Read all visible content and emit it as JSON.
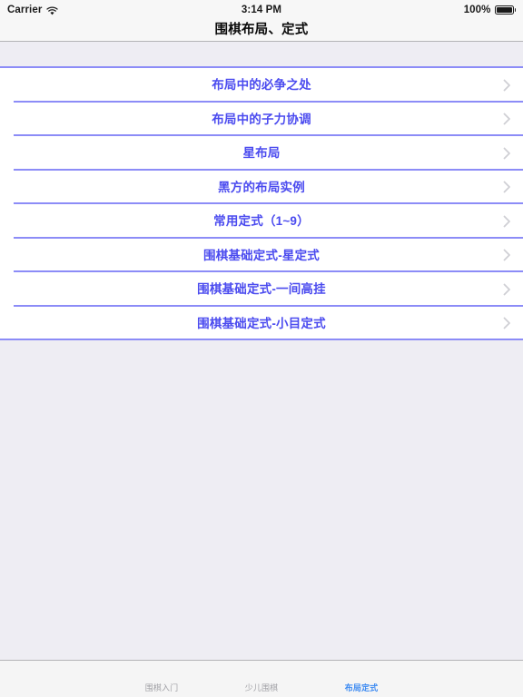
{
  "status_bar": {
    "carrier": "Carrier",
    "wifi_icon": "wifi-icon",
    "time": "3:14 PM",
    "battery_percent": "100%",
    "battery_icon": "battery-full-icon"
  },
  "nav_bar": {
    "title": "围棋布局、定式"
  },
  "list": {
    "chevron_icon": "chevron-right-icon",
    "rows": [
      {
        "label": "布局中的必争之处"
      },
      {
        "label": "布局中的子力协调"
      },
      {
        "label": "星布局"
      },
      {
        "label": "黑方的布局实例"
      },
      {
        "label": "常用定式（1~9）"
      },
      {
        "label": "围棋基础定式-星定式"
      },
      {
        "label": "围棋基础定式-一间高挂"
      },
      {
        "label": "围棋基础定式-小目定式"
      }
    ]
  },
  "tab_bar": {
    "tabs": [
      {
        "label": "围棋入门",
        "active": false
      },
      {
        "label": "少儿围棋",
        "active": false
      },
      {
        "label": "布局定式",
        "active": true
      }
    ]
  },
  "colors": {
    "separator_blue": "#8c8cf7",
    "row_text_blue": "#4b4bef",
    "active_tab_blue": "#3e8bf2",
    "content_bg": "#eeedf3",
    "bar_bg": "#f7f7f7"
  }
}
